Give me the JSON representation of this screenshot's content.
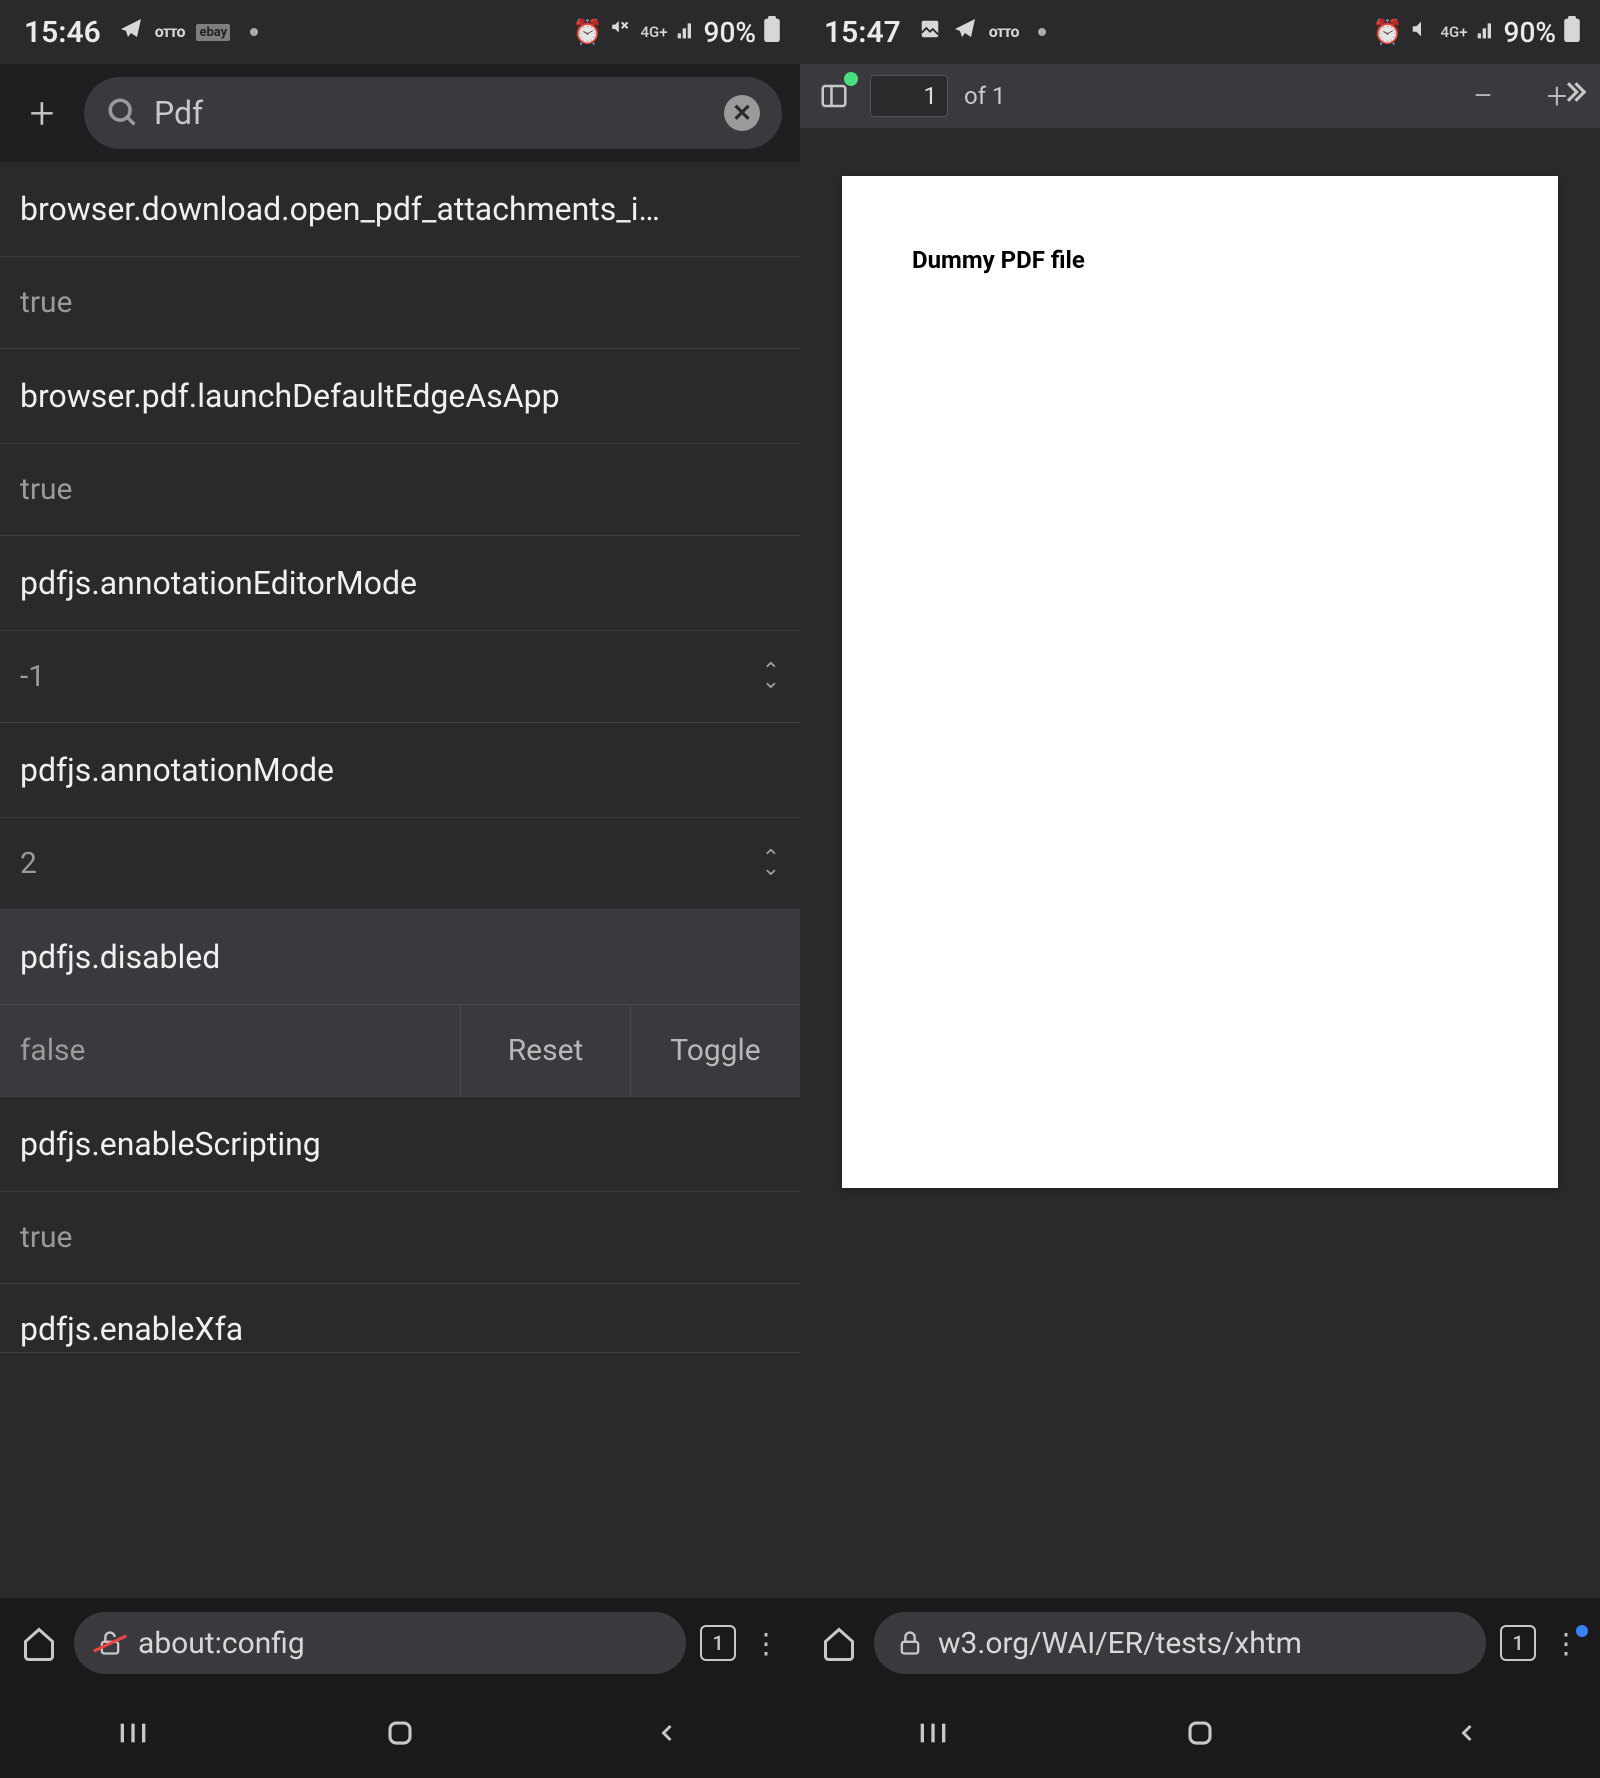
{
  "left": {
    "status": {
      "time": "15:46",
      "battery": "90%"
    },
    "search": {
      "value": "Pdf"
    },
    "items": [
      {
        "name": "browser.download.open_pdf_attachments_i…",
        "value": "true",
        "type": "bool"
      },
      {
        "name": "browser.pdf.launchDefaultEdgeAsApp",
        "value": "true",
        "type": "bool"
      },
      {
        "name": "pdfjs.annotationEditorMode",
        "value": "-1",
        "type": "int"
      },
      {
        "name": "pdfjs.annotationMode",
        "value": "2",
        "type": "int"
      },
      {
        "name": "pdfjs.disabled",
        "value": "false",
        "type": "bool",
        "selected": true,
        "actions": {
          "reset": "Reset",
          "toggle": "Toggle"
        }
      },
      {
        "name": "pdfjs.enableScripting",
        "value": "true",
        "type": "bool"
      },
      {
        "name": "pdfjs.enableXfa",
        "value": "",
        "type": "partial"
      }
    ],
    "url": "about:config",
    "tabs": "1"
  },
  "right": {
    "status": {
      "time": "15:47",
      "battery": "90%"
    },
    "toolbar": {
      "page_current": "1",
      "page_of": "of 1"
    },
    "doc": {
      "title": "Dummy PDF file"
    },
    "url": "w3.org/WAI/ER/tests/xhtm",
    "tabs": "1"
  }
}
